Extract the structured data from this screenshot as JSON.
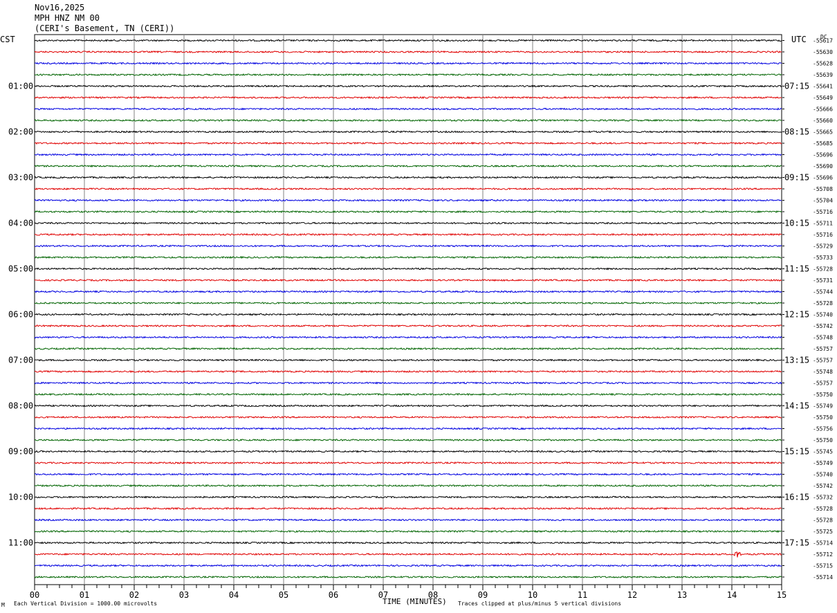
{
  "header": {
    "date": "Nov16,2025",
    "station": "MPH HNZ NM 00",
    "location": "(CERI's Basement, TN (CERI))"
  },
  "corners": {
    "left_tz": "CST",
    "right_tz": "UTC",
    "dc_label": "DC"
  },
  "footer": {
    "scale_note": "Each Vertical Division = 1000.00 microvolts",
    "clip_note": "Traces clipped at plus/minus 5 vertical divisions",
    "logo_text": "M"
  },
  "colors": {
    "trace_cycle": [
      "#000000",
      "#e00000",
      "#0000e0",
      "#006400"
    ],
    "grid": "#808080"
  },
  "chart_data": {
    "type": "line",
    "title": "MPH HNZ NM 00",
    "xlabel": "TIME (MINUTES)",
    "xlim": [
      0,
      15
    ],
    "x_ticks": [
      "00",
      "01",
      "02",
      "03",
      "04",
      "05",
      "06",
      "07",
      "08",
      "09",
      "10",
      "11",
      "12",
      "13",
      "14",
      "15"
    ],
    "x_minor_per_minute": 4,
    "left_hour_labels": [
      "01:00",
      "02:00",
      "03:00",
      "04:00",
      "05:00",
      "06:00",
      "07:00",
      "08:00",
      "09:00",
      "10:00",
      "11:00"
    ],
    "right_hour_labels": [
      "07:15",
      "08:15",
      "09:15",
      "10:15",
      "11:15",
      "12:15",
      "13:15",
      "14:15",
      "15:15",
      "16:15",
      "17:15"
    ],
    "hour_label_trace_index": [
      4,
      8,
      12,
      16,
      20,
      24,
      28,
      32,
      36,
      40,
      44
    ],
    "dc_offsets": [
      -55617,
      -55630,
      -55628,
      -55639,
      -55641,
      -55649,
      -55666,
      -55660,
      -55665,
      -55685,
      -55696,
      -55690,
      -55696,
      -55708,
      -55704,
      -55716,
      -55711,
      -55716,
      -55729,
      -55733,
      -55728,
      -55731,
      -55744,
      -55728,
      -55740,
      -55742,
      -55748,
      -55757,
      -55757,
      -55748,
      -55757,
      -55750,
      -55749,
      -55750,
      -55756,
      -55750,
      -55745,
      -55749,
      -55740,
      -55742,
      -55732,
      -55728,
      -55728,
      -55725,
      -55714,
      -55712,
      -55715,
      -55714
    ],
    "events": [
      {
        "trace": 45,
        "minute": 14.1,
        "label": ""
      }
    ]
  }
}
